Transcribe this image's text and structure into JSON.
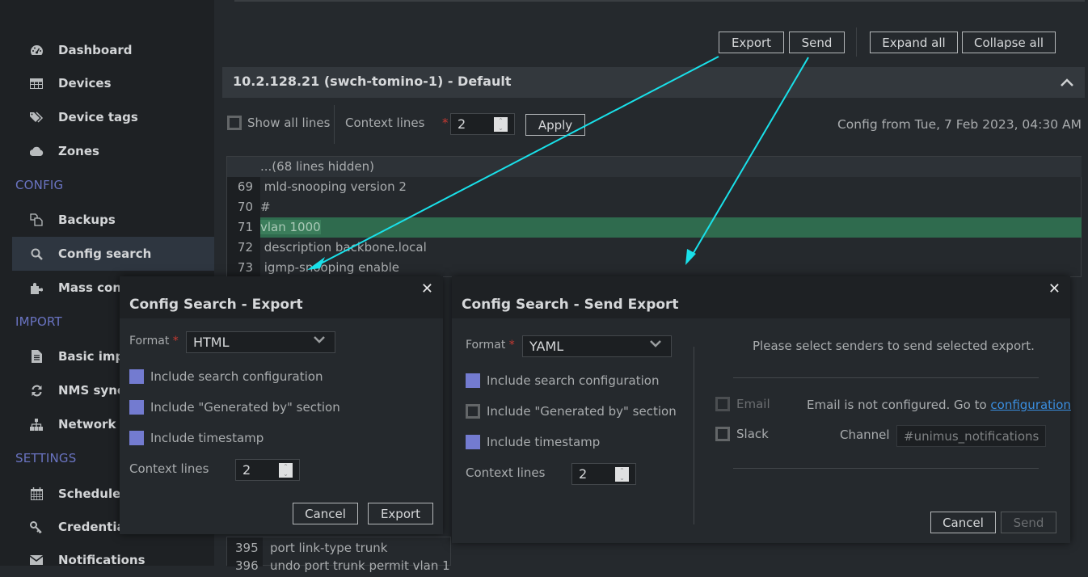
{
  "sidebar": {
    "items": [
      {
        "label": "Dashboard",
        "icon": "dashboard-icon"
      },
      {
        "label": "Devices",
        "icon": "table-icon"
      },
      {
        "label": "Device tags",
        "icon": "tags-icon"
      },
      {
        "label": "Zones",
        "icon": "cloud-icon"
      },
      {
        "label": "Backups",
        "icon": "copy-icon"
      },
      {
        "label": "Config search",
        "icon": "search-icon",
        "active": true
      },
      {
        "label": "Mass config",
        "icon": "puzzle-icon"
      },
      {
        "label": "Basic import",
        "icon": "file-icon"
      },
      {
        "label": "NMS sync",
        "icon": "refresh-icon"
      },
      {
        "label": "Network scan",
        "icon": "sitemap-icon"
      },
      {
        "label": "Schedules",
        "icon": "calendar-icon"
      },
      {
        "label": "Credentials",
        "icon": "key-icon"
      },
      {
        "label": "Notifications",
        "icon": "envelope-icon"
      }
    ],
    "sections": {
      "config": "CONFIG",
      "import": "IMPORT",
      "settings": "SETTINGS"
    }
  },
  "toolbar": {
    "export_label": "Export",
    "send_label": "Send",
    "expand_all_label": "Expand all",
    "collapse_all_label": "Collapse all"
  },
  "device": {
    "title": "10.2.128.21 (swch-tomino-1) - Default",
    "show_all_lines_label": "Show all lines",
    "show_all_lines_checked": false,
    "context_lines_label": "Context lines",
    "context_lines_value": "2",
    "apply_label": "Apply",
    "config_from": "Config from Tue, 7 Feb 2023, 04:30 AM",
    "code_lines": [
      {
        "num": "",
        "text": "...(68 lines hidden)",
        "type": "hidden"
      },
      {
        "num": "69",
        "text": " mld-snooping version 2",
        "type": "normal"
      },
      {
        "num": "70",
        "text": "#",
        "type": "normal"
      },
      {
        "num": "71",
        "text": "vlan 1000",
        "type": "match"
      },
      {
        "num": "72",
        "text": " description backbone.local",
        "type": "normal"
      },
      {
        "num": "73",
        "text": " igmp-snooping enable",
        "type": "normal"
      }
    ],
    "background_lines": [
      {
        "num": "395",
        "text": "port link-type trunk"
      },
      {
        "num": "396",
        "text": "undo port trunk permit vlan 1"
      }
    ]
  },
  "export_modal": {
    "title": "Config Search - Export",
    "format_label": "Format",
    "format_value": "HTML",
    "options": [
      {
        "label": "Include search configuration",
        "checked": true
      },
      {
        "label": "Include \"Generated by\" section",
        "checked": true
      },
      {
        "label": "Include timestamp",
        "checked": true
      }
    ],
    "context_lines_label": "Context lines",
    "context_lines_value": "2",
    "cancel_label": "Cancel",
    "submit_label": "Export"
  },
  "send_modal": {
    "title": "Config Search - Send Export",
    "format_label": "Format",
    "format_value": "YAML",
    "options": [
      {
        "label": "Include search configuration",
        "checked": true
      },
      {
        "label": "Include \"Generated by\" section",
        "checked": false
      },
      {
        "label": "Include timestamp",
        "checked": true
      }
    ],
    "context_lines_label": "Context lines",
    "context_lines_value": "2",
    "senders_prompt": "Please select senders to send selected export.",
    "email_label": "Email",
    "email_status": "Email is not configured. Go to ",
    "email_link": "configuration",
    "slack_label": "Slack",
    "channel_label": "Channel",
    "channel_value": "#unimus_notifications",
    "cancel_label": "Cancel",
    "submit_label": "Send"
  },
  "colors": {
    "accent": "#737bd0",
    "match_highlight": "#2f6b4e",
    "annotation_arrow": "#19e1ea",
    "required": "#c83a32",
    "link": "#3a8ee0"
  }
}
